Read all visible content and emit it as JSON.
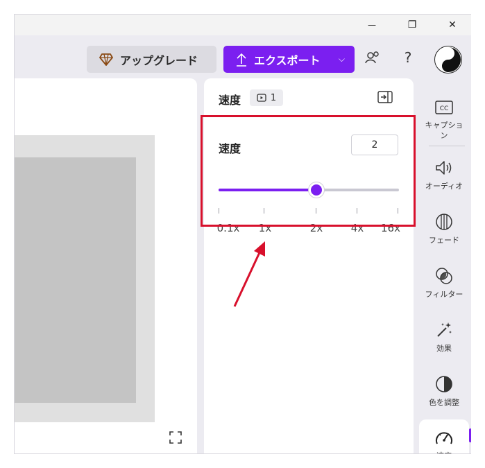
{
  "window": {
    "minimize": "—",
    "restore": "❐",
    "close": "✕"
  },
  "toolbar": {
    "upgrade_label": "アップグレード",
    "export_label": "エクスポート",
    "export_chevron": "⌵",
    "help": "?"
  },
  "panel": {
    "title": "速度",
    "clip_count": "1",
    "speed_label": "速度",
    "speed_value": "2",
    "slider_fraction": 0.542,
    "ticks": [
      "0.1x",
      "1x",
      "2x",
      "4x",
      "16x"
    ]
  },
  "sidebar": {
    "items": [
      {
        "label": "キャプション",
        "icon": "captions-icon"
      },
      {
        "label": "オーディオ",
        "icon": "audio-icon"
      },
      {
        "label": "フェード",
        "icon": "fade-icon"
      },
      {
        "label": "フィルター",
        "icon": "filter-icon"
      },
      {
        "label": "効果",
        "icon": "effects-icon"
      },
      {
        "label": "色を調整",
        "icon": "adjust-color-icon"
      },
      {
        "label": "速度",
        "icon": "speed-icon"
      }
    ]
  },
  "colors": {
    "accent": "#7b1ff0",
    "highlight": "#d8102c"
  }
}
